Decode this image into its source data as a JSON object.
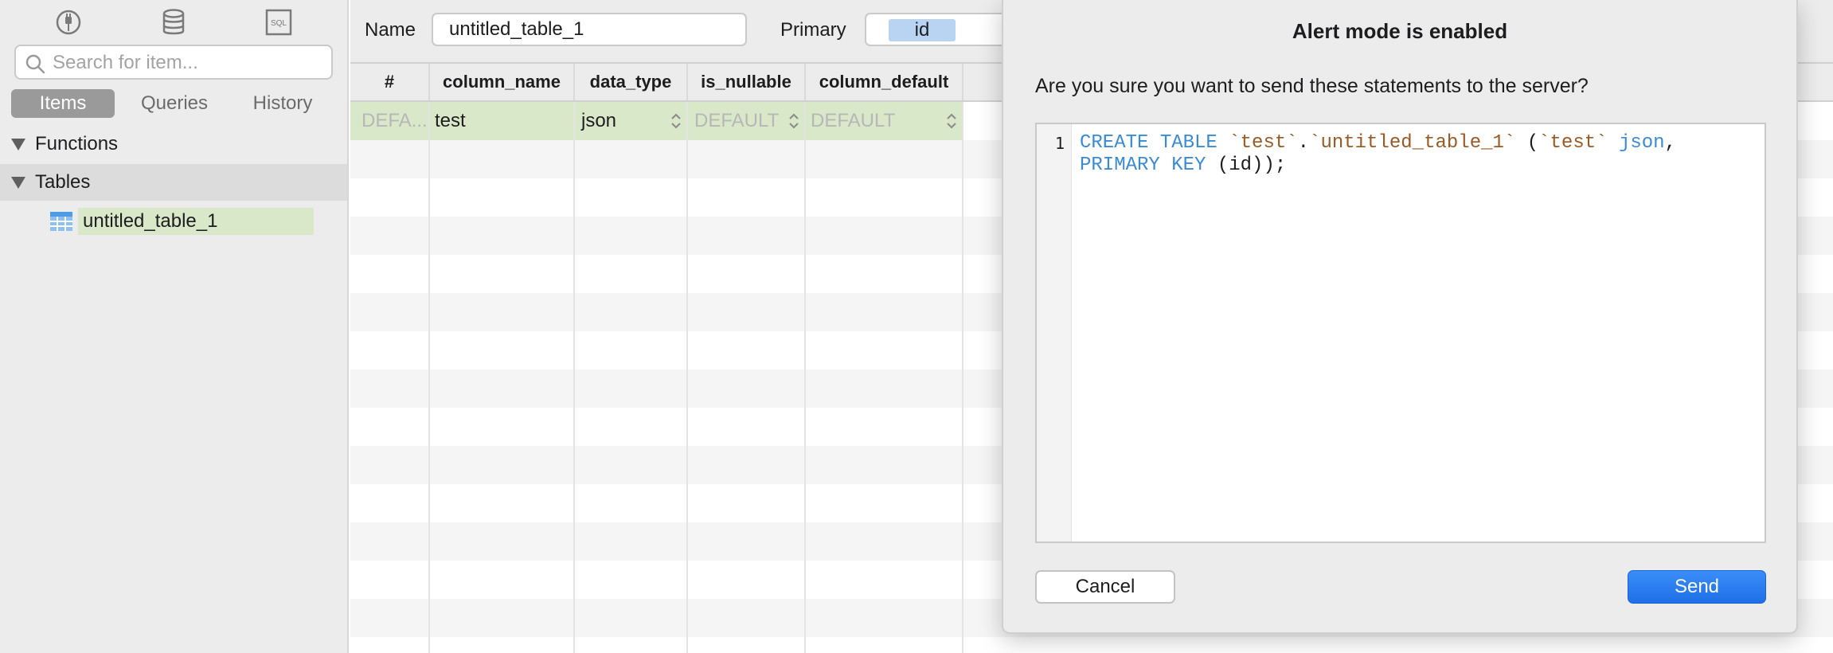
{
  "sidebar": {
    "icons": [
      "plug-icon",
      "database-icon",
      "sql-file-icon"
    ],
    "sql_icon_text": "SQL",
    "search_placeholder": "Search for item...",
    "tabs": [
      {
        "label": "Items",
        "active": true
      },
      {
        "label": "Queries",
        "active": false
      },
      {
        "label": "History",
        "active": false
      }
    ],
    "tree": {
      "functions_label": "Functions",
      "tables_label": "Tables",
      "table_item": "untitled_table_1"
    }
  },
  "editor_header": {
    "name_label": "Name",
    "name_value": "untitled_table_1",
    "primary_label": "Primary",
    "primary_key": "id"
  },
  "grid": {
    "columns": [
      "#",
      "column_name",
      "data_type",
      "is_nullable",
      "column_default"
    ],
    "row": {
      "index": "DEFA...",
      "column_name": "test",
      "data_type": "json",
      "is_nullable": "DEFAULT",
      "column_default": "DEFAULT"
    }
  },
  "dialog": {
    "title": "Alert mode is enabled",
    "message": "Are you sure you want to send these statements to the server?",
    "line_number": "1",
    "sql": {
      "kw_create_table": "CREATE TABLE ",
      "schema": "`test`",
      "dot": ".",
      "table": "`untitled_table_1`",
      "open": " (",
      "column": "`test`",
      "space": " ",
      "type": "json",
      "comma": ",",
      "kw_primary_key": "PRIMARY KEY",
      "tail": " (id));"
    },
    "cancel_label": "Cancel",
    "send_label": "Send"
  },
  "colors": {
    "accent": "#1f6fe6",
    "selection_green": "#d9e8c9",
    "keyword_blue": "#3a8bd4",
    "string_brown": "#9b5a24"
  }
}
